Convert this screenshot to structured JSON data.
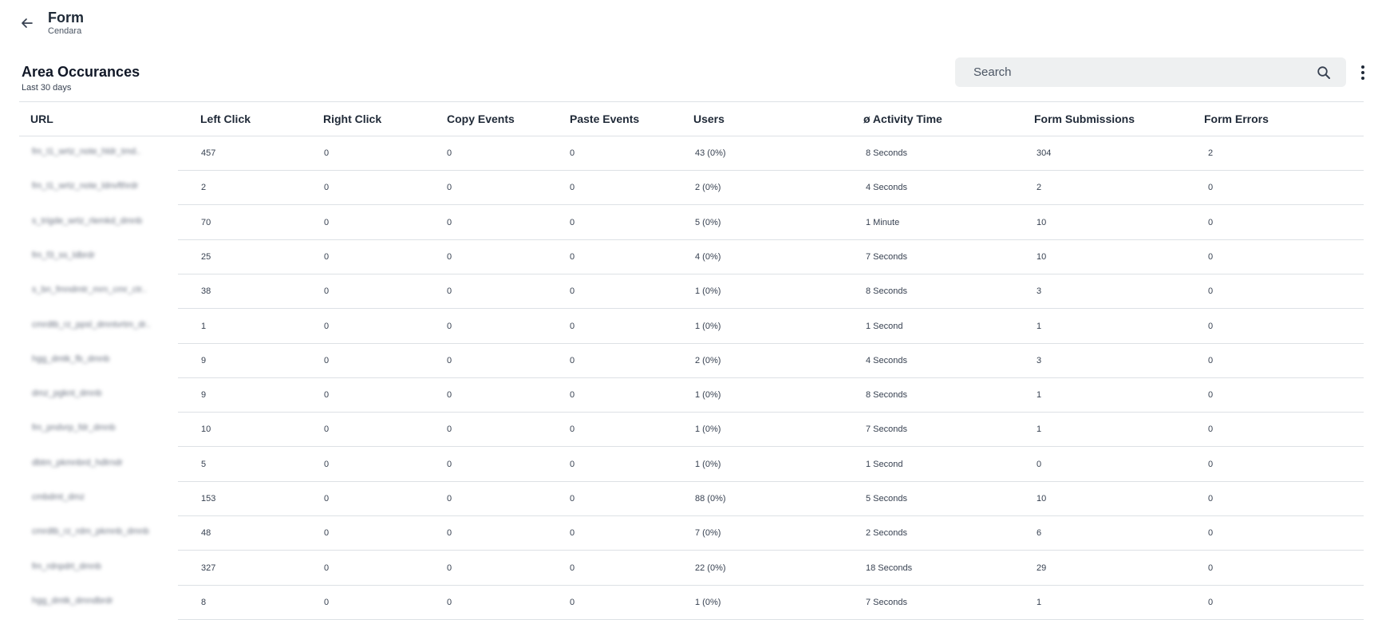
{
  "header": {
    "title": "Form",
    "subtitle": "Cendara"
  },
  "section": {
    "title": "Area Occurances",
    "subtitle": "Last 30 days"
  },
  "search": {
    "placeholder": "Search",
    "value": ""
  },
  "icons": {
    "back": "arrow-left-icon",
    "search": "search-icon",
    "menu": "more-vertical-icon"
  },
  "colors": {
    "border": "#dde1e5",
    "search_bg": "#eef0f1",
    "text": "#1f2937"
  },
  "table": {
    "columns": [
      "URL",
      "Left Click",
      "Right Click",
      "Copy Events",
      "Paste Events",
      "Users",
      "ø Activity Time",
      "Form Submissions",
      "Form Errors"
    ],
    "rows": [
      [
        "fm_t1_wrtz_note_hldr_tmd..",
        "457",
        "0",
        "0",
        "0",
        "43 (0%)",
        "8 Seconds",
        "304",
        "2"
      ],
      [
        "fm_t1_wrtz_note_ldnvfthrdr",
        "2",
        "0",
        "0",
        "0",
        "2 (0%)",
        "4 Seconds",
        "2",
        "0"
      ],
      [
        "s_trigde_wrtz_rlemkd_dmnb",
        "70",
        "0",
        "0",
        "0",
        "5 (0%)",
        "1 Minute",
        "10",
        "0"
      ],
      [
        "fm_f3_ss_ldbrdr",
        "25",
        "0",
        "0",
        "0",
        "4 (0%)",
        "7 Seconds",
        "10",
        "0"
      ],
      [
        "s_bn_fmndmtr_mrn_cmr_ctr..",
        "38",
        "0",
        "0",
        "0",
        "1 (0%)",
        "8 Seconds",
        "3",
        "0"
      ],
      [
        "cmrdtb_rz_ppsl_dmntvrtm_dr..",
        "1",
        "0",
        "0",
        "0",
        "1 (0%)",
        "1 Second",
        "1",
        "0"
      ],
      [
        "hgg_dmtk_fb_dmnb",
        "9",
        "0",
        "0",
        "0",
        "2 (0%)",
        "4 Seconds",
        "3",
        "0"
      ],
      [
        "dmz_pgknt_dmnb",
        "9",
        "0",
        "0",
        "0",
        "1 (0%)",
        "8 Seconds",
        "1",
        "0"
      ],
      [
        "fm_pndvrp_fdr_dmnb",
        "10",
        "0",
        "0",
        "0",
        "1 (0%)",
        "7 Seconds",
        "1",
        "0"
      ],
      [
        "dbtm_pkmnbrd_hdlrndr",
        "5",
        "0",
        "0",
        "0",
        "1 (0%)",
        "1 Second",
        "0",
        "0"
      ],
      [
        "cmbdmt_dmz",
        "153",
        "0",
        "0",
        "0",
        "88 (0%)",
        "5 Seconds",
        "10",
        "0"
      ],
      [
        "cmrdtb_rz_rdm_pkmnb_dmnb",
        "48",
        "0",
        "0",
        "0",
        "7 (0%)",
        "2 Seconds",
        "6",
        "0"
      ],
      [
        "fm_rdnpdrt_dmnb",
        "327",
        "0",
        "0",
        "0",
        "22 (0%)",
        "18 Seconds",
        "29",
        "0"
      ],
      [
        "hgg_dmtk_dmndbrdr",
        "8",
        "0",
        "0",
        "0",
        "1 (0%)",
        "7 Seconds",
        "1",
        "0"
      ]
    ]
  }
}
